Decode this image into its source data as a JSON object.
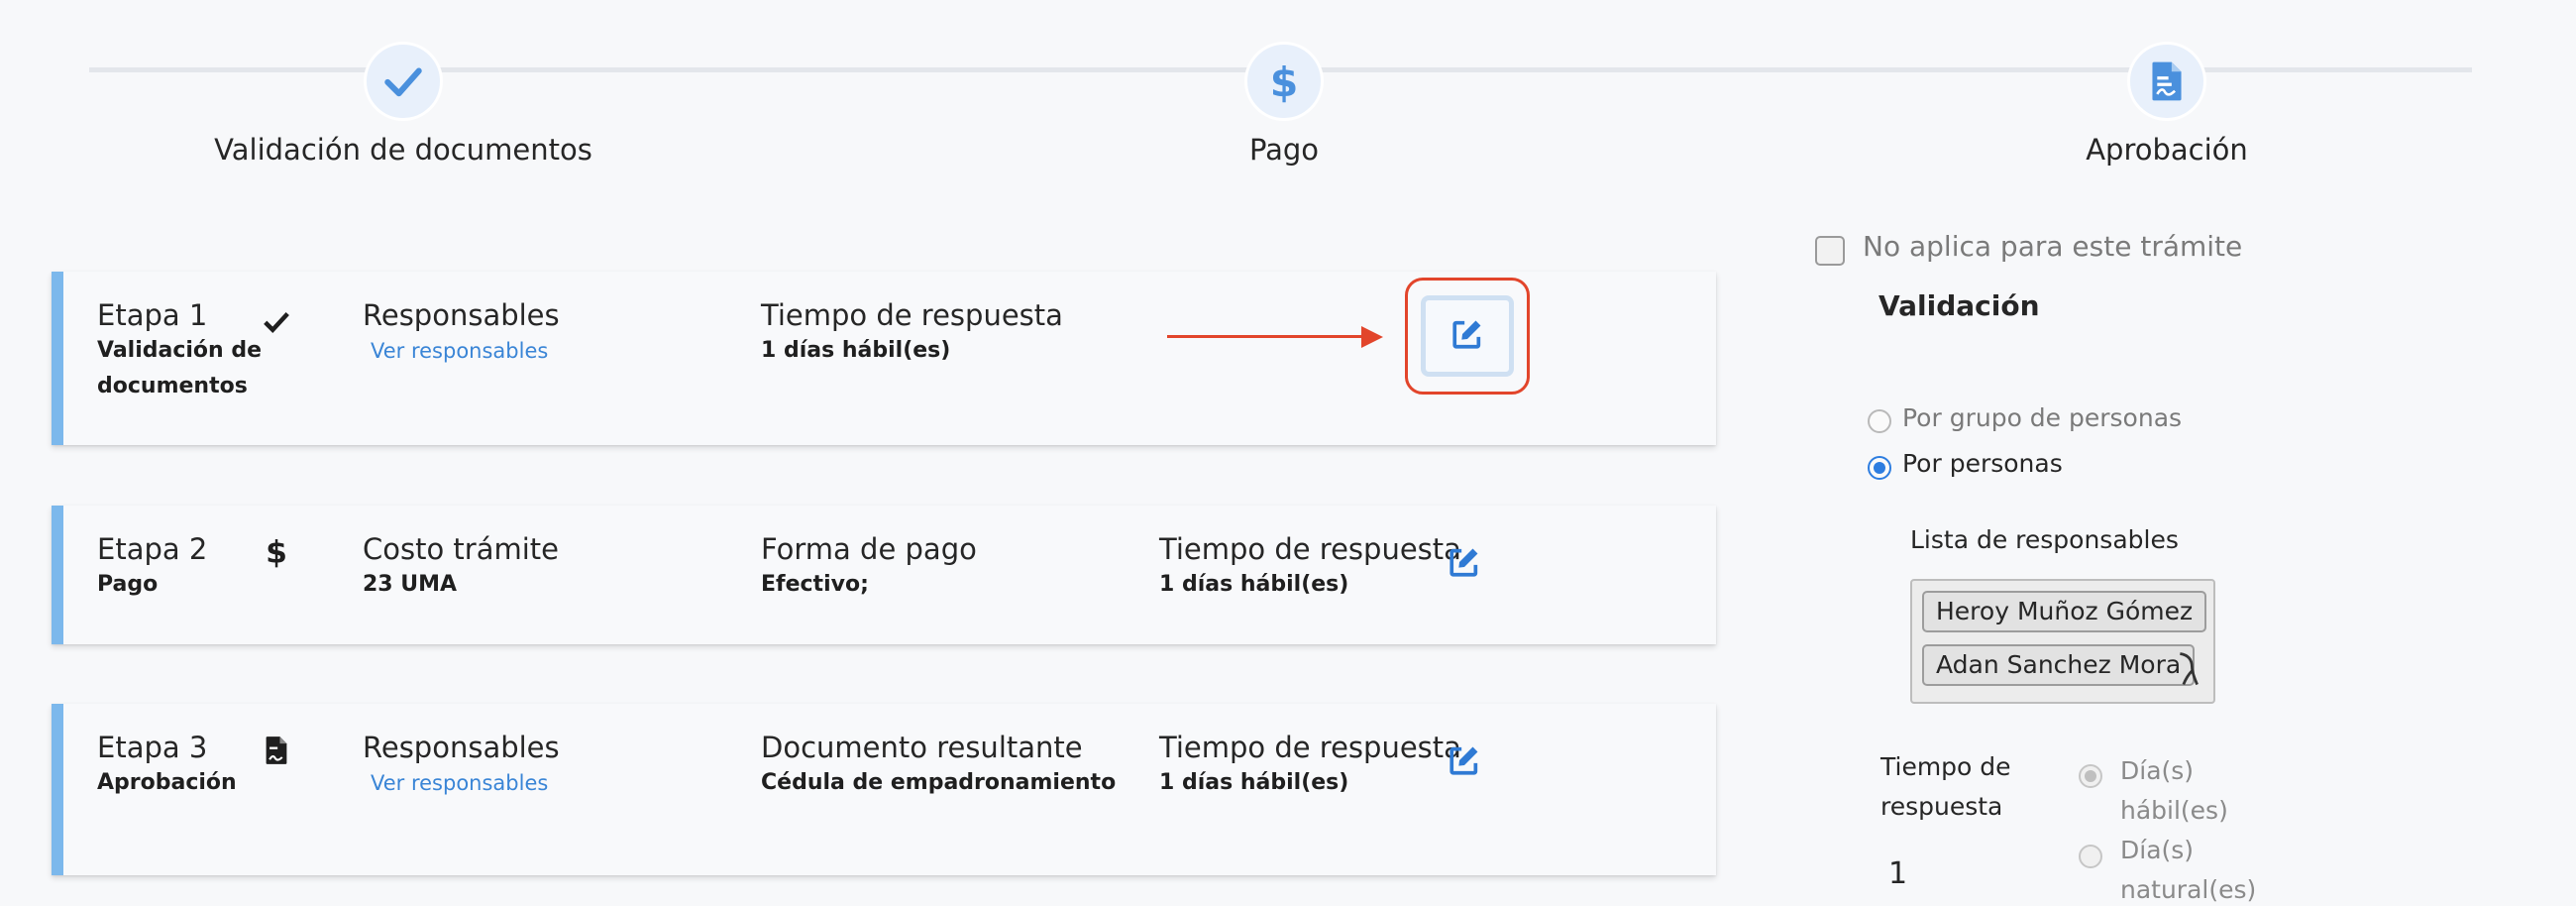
{
  "stepper": {
    "steps": [
      {
        "label": "Validación de documentos",
        "icon": "check-icon"
      },
      {
        "label": "Pago",
        "icon": "dollar-icon"
      },
      {
        "label": "Aprobación",
        "icon": "document-icon"
      }
    ]
  },
  "cards": [
    {
      "stage": "Etapa 1",
      "stage_name_line1": "Validación de",
      "stage_name_line2": "documentos",
      "icon": "check-icon",
      "col1_title": "Responsables",
      "col1_link": "Ver responsables",
      "col2_title": "Tiempo de respuesta",
      "col2_value": "1 días hábil(es)"
    },
    {
      "stage": "Etapa 2",
      "stage_name": "Pago",
      "icon": "dollar-icon",
      "col1_title": "Costo trámite",
      "col1_value": "23 UMA",
      "col2_title": "Forma de pago",
      "col2_value": "Efectivo;",
      "col3_title": "Tiempo de respuesta",
      "col3_value": "1 días hábil(es)"
    },
    {
      "stage": "Etapa 3",
      "stage_name": "Aprobación",
      "icon": "document-icon",
      "col1_title": "Responsables",
      "col1_link": "Ver responsables",
      "col2_title": "Documento resultante",
      "col2_value": "Cédula de empadronamiento",
      "col3_title": "Tiempo de respuesta",
      "col3_value": "1 días hábil(es)"
    }
  ],
  "panel": {
    "no_aplica_label": "No aplica para este trámite",
    "no_aplica_checked": false,
    "section_title": "Validación",
    "radio_group": [
      {
        "label": "Por grupo de personas",
        "selected": false
      },
      {
        "label": "Por personas",
        "selected": true
      }
    ],
    "list_label": "Lista de responsables",
    "responsables": [
      "Heroy Muñoz Gómez",
      "Adan Sanchez Mora"
    ],
    "tiempo_label_line1": "Tiempo de",
    "tiempo_label_line2": "respuesta",
    "tiempo_value": "1",
    "tiempo_options": [
      {
        "line1": "Día(s)",
        "line2": "hábil(es)",
        "selected": true
      },
      {
        "line1": "Día(s)",
        "line2": "natural(es)",
        "selected": false
      }
    ]
  },
  "colors": {
    "accent": "#3a85d6",
    "card_border": "#7cb8ec",
    "highlight": "#e2452b"
  }
}
